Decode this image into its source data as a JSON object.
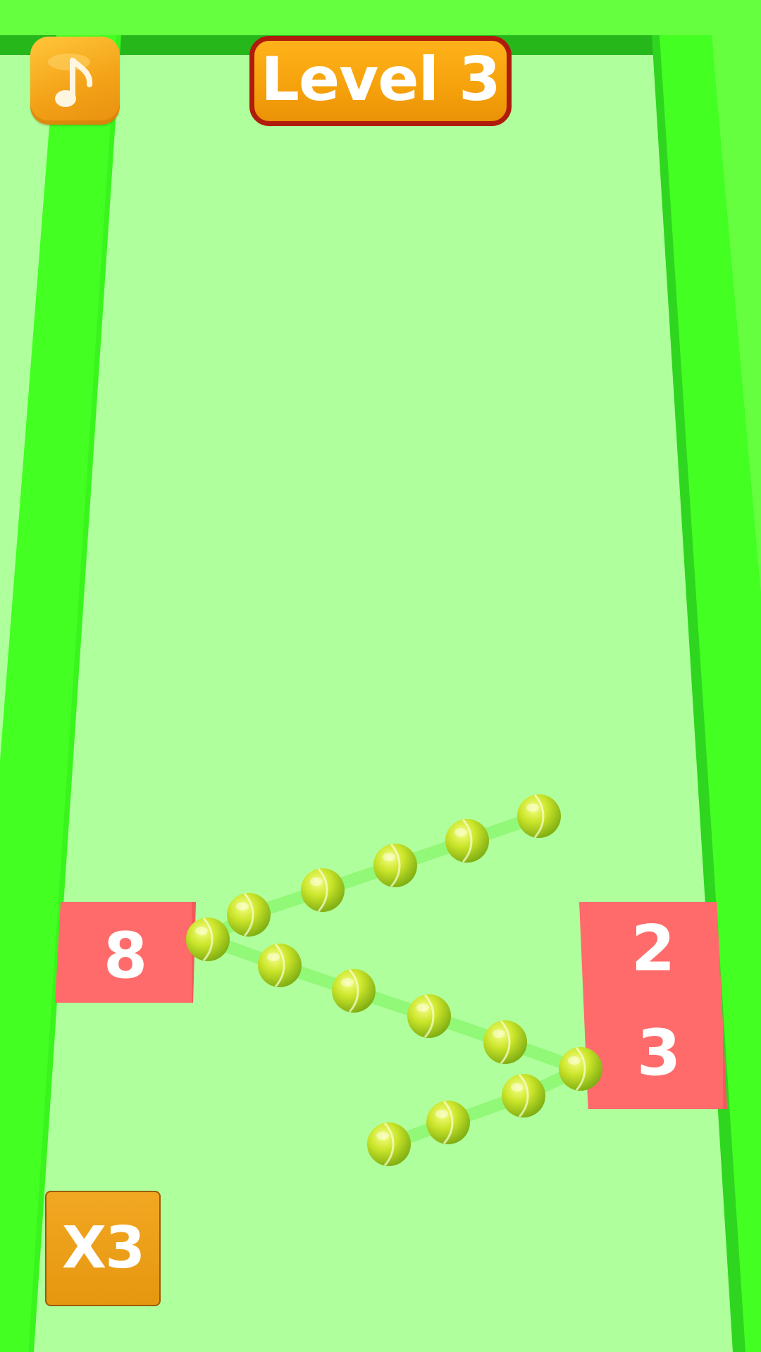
{
  "hud": {
    "level_label": "Level 3",
    "music_icon": "music-note-icon"
  },
  "gates": {
    "left": {
      "value": "8"
    },
    "right": {
      "top_value": "2",
      "bottom_value": "3"
    }
  },
  "multiplier": {
    "label": "X3"
  },
  "ball_chain": {
    "ball_count": 15,
    "ball_icon": "tennis-ball-icon"
  },
  "colors": {
    "floor": "#b0ff9d",
    "wall": "#43ff22",
    "wall_dark": "#2fd61f",
    "gate": "#ff6b6b",
    "button_orange": "#f5a10b",
    "banner_border": "#b01c0c",
    "ball": "#c8e825"
  }
}
